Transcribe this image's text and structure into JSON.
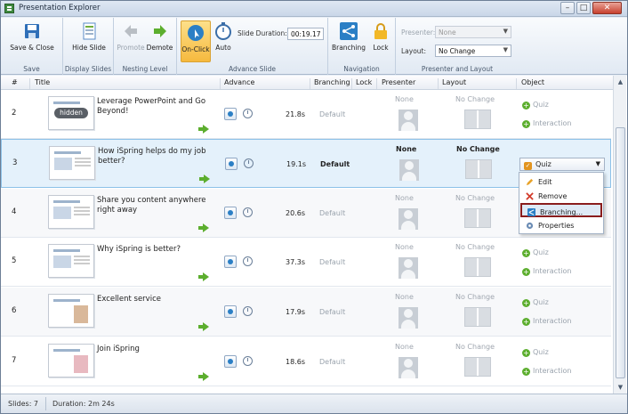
{
  "window": {
    "title": "Presentation Explorer",
    "minimize": "–",
    "maximize": "□",
    "close": "✕"
  },
  "ribbon": {
    "groups": {
      "save": "Save",
      "display": "Display Slides",
      "nesting": "Nesting Level",
      "advance": "Advance Slide",
      "navigation": "Navigation",
      "presenter": "Presenter and Layout"
    },
    "buttons": {
      "save_close": "Save & Close",
      "hide_slide": "Hide Slide",
      "promote": "Promote",
      "demote": "Demote",
      "on_click": "On-Click",
      "auto": "Auto",
      "branching": "Branching",
      "lock": "Lock"
    },
    "slide_duration_label": "Slide Duration:",
    "slide_duration_value": "00:19.17",
    "presenter_label": "Presenter:",
    "presenter_value": "None",
    "layout_label": "Layout:",
    "layout_value": "No Change"
  },
  "columns": [
    "#",
    "Title",
    "Advance",
    "Branching",
    "Lock",
    "Presenter",
    "Layout",
    "Object"
  ],
  "slides": [
    {
      "num": "2",
      "title": "Leverage PowerPoint and Go Beyond!",
      "hidden_badge": "hidden",
      "duration": "21.8s",
      "branching": "Default",
      "presenter": "None",
      "layout": "No Change",
      "obj1": "Quiz",
      "obj2": "Interaction"
    },
    {
      "num": "3",
      "title": "How iSpring helps do my job better?",
      "duration": "19.1s",
      "branching": "Default",
      "presenter": "None",
      "layout": "No Change",
      "obj_dropdown": "Quiz"
    },
    {
      "num": "4",
      "title": "Share you content anywhere right away",
      "duration": "20.6s",
      "branching": "Default",
      "presenter": "None",
      "layout": "No Change",
      "obj1": "Quiz",
      "obj2": "Interaction"
    },
    {
      "num": "5",
      "title": "Why iSpring is better?",
      "duration": "37.3s",
      "branching": "Default",
      "presenter": "None",
      "layout": "No Change",
      "obj1": "Quiz",
      "obj2": "Interaction"
    },
    {
      "num": "6",
      "title": "Excellent service",
      "duration": "17.9s",
      "branching": "Default",
      "presenter": "None",
      "layout": "No Change",
      "obj1": "Quiz",
      "obj2": "Interaction"
    },
    {
      "num": "7",
      "title": "Join iSpring",
      "duration": "18.6s",
      "branching": "Default",
      "presenter": "None",
      "layout": "No Change",
      "obj1": "Quiz",
      "obj2": "Interaction"
    }
  ],
  "context_menu": {
    "edit": "Edit",
    "remove": "Remove",
    "branching": "Branching...",
    "properties": "Properties"
  },
  "status": {
    "slides": "Slides: 7",
    "duration": "Duration:  2m 24s"
  },
  "colors": {
    "accent_green": "#5cae2e",
    "selection": "#e4f1fb",
    "highlight_border": "#8a1d1d"
  }
}
